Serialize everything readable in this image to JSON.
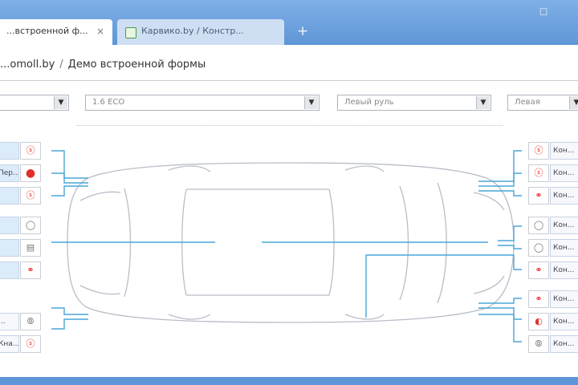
{
  "browser": {
    "tabs": [
      {
        "label": "...встроенной ф...",
        "close": "×",
        "active": true
      },
      {
        "label": "Карвико.by / Констр...",
        "active": false
      }
    ],
    "new_tab_symbol": "+",
    "window_control_symbol": "◻"
  },
  "breadcrumb": {
    "site": "...omoll.by",
    "separator": "/",
    "page": "Демо встроенной формы"
  },
  "filters": [
    {
      "value": "",
      "arrow": "▼"
    },
    {
      "value": "1.6 ECO",
      "arrow": "▼"
    },
    {
      "value": "Левый руль",
      "arrow": "▼"
    },
    {
      "value": "Левая",
      "arrow": "▼"
    }
  ],
  "left_panel": [
    {
      "label": "",
      "icon": "sensor-icon",
      "glyph": "ⓢ",
      "tone": "red"
    },
    {
      "label": "Пер...",
      "icon": "sensor-filled-icon",
      "glyph": "●",
      "tone": "redfill"
    },
    {
      "label": "",
      "icon": "sensor-icon",
      "glyph": "ⓢ",
      "tone": "red"
    },
    {
      "label": "",
      "icon": "ring-icon",
      "glyph": "◯",
      "tone": "gray"
    },
    {
      "label": "",
      "icon": "grille-icon",
      "glyph": "▤",
      "tone": "gray"
    },
    {
      "label": "",
      "icon": "pair-icon",
      "glyph": "⚭",
      "tone": "red"
    },
    {
      "label": "...",
      "icon": "dual-icon",
      "glyph": "⦾",
      "tone": "gray"
    },
    {
      "label": "Кна...",
      "icon": "sensor-icon",
      "glyph": "ⓢ",
      "tone": "red"
    }
  ],
  "right_panel": [
    {
      "label": "Кон...",
      "icon": "sensor-icon",
      "glyph": "ⓢ",
      "tone": "red"
    },
    {
      "label": "Кон...",
      "icon": "sensor-icon",
      "glyph": "ⓢ",
      "tone": "red"
    },
    {
      "label": "Кон...",
      "icon": "pair-icon",
      "glyph": "⚭",
      "tone": "red"
    },
    {
      "label": "Кон...",
      "icon": "ring-icon",
      "glyph": "◯",
      "tone": "gray"
    },
    {
      "label": "Кон...",
      "icon": "ring-icon",
      "glyph": "◯",
      "tone": "gray"
    },
    {
      "label": "Кон...",
      "icon": "pair-icon",
      "glyph": "⚭",
      "tone": "red"
    },
    {
      "label": "Кон...",
      "icon": "pair-icon",
      "glyph": "⚭",
      "tone": "red"
    },
    {
      "label": "Кон...",
      "icon": "sensor-filled-icon",
      "glyph": "◐",
      "tone": "red"
    },
    {
      "label": "Кон...",
      "icon": "dual-icon",
      "glyph": "⦾",
      "tone": "gray"
    }
  ],
  "colors": {
    "accent_blue": "#5e95d6",
    "connector_line": "#4aa5d8",
    "alert_red": "#e0302c"
  }
}
